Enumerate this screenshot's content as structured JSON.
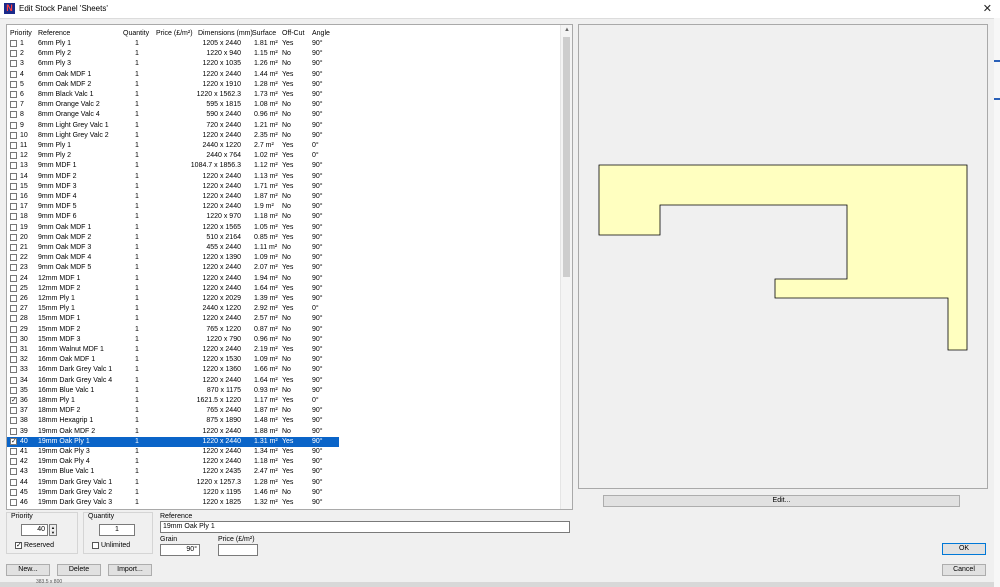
{
  "window": {
    "title": "Edit Stock Panel 'Sheets'",
    "close": "✕"
  },
  "table": {
    "headers": {
      "priority": "Priority",
      "reference": "Reference",
      "quantity": "Quantity",
      "price": "Price (£/m²)",
      "dimensions": "Dimensions (mm)",
      "surface": "Surface",
      "offcut": "Off-Cut",
      "angle": "Angle"
    },
    "selected_index": 39,
    "rows": [
      {
        "p": "1",
        "ref": "6mm Ply 1",
        "qty": "1",
        "dim": "1205 x 2440",
        "surf": "1.81 m²",
        "off": "Yes",
        "ang": "90°",
        "checked": false
      },
      {
        "p": "2",
        "ref": "6mm Ply 2",
        "qty": "1",
        "dim": "1220 x 940",
        "surf": "1.15 m²",
        "off": "No",
        "ang": "90°",
        "checked": false
      },
      {
        "p": "3",
        "ref": "6mm Ply 3",
        "qty": "1",
        "dim": "1220 x 1035",
        "surf": "1.26 m²",
        "off": "No",
        "ang": "90°",
        "checked": false
      },
      {
        "p": "4",
        "ref": "6mm Oak MDF 1",
        "qty": "1",
        "dim": "1220 x 2440",
        "surf": "1.44 m²",
        "off": "Yes",
        "ang": "90°",
        "checked": false
      },
      {
        "p": "5",
        "ref": "6mm Oak MDF 2",
        "qty": "1",
        "dim": "1220 x 1910",
        "surf": "1.28 m²",
        "off": "Yes",
        "ang": "90°",
        "checked": false
      },
      {
        "p": "6",
        "ref": "8mm Black Valc 1",
        "qty": "1",
        "dim": "1220 x 1562.3",
        "surf": "1.73 m²",
        "off": "Yes",
        "ang": "90°",
        "checked": false
      },
      {
        "p": "7",
        "ref": "8mm Orange Valc 2",
        "qty": "1",
        "dim": "595 x 1815",
        "surf": "1.08 m²",
        "off": "No",
        "ang": "90°",
        "checked": false
      },
      {
        "p": "8",
        "ref": "8mm Orange Valc 4",
        "qty": "1",
        "dim": "590 x 2440",
        "surf": "0.96 m²",
        "off": "No",
        "ang": "90°",
        "checked": false
      },
      {
        "p": "9",
        "ref": "8mm Light Grey Valc 1",
        "qty": "1",
        "dim": "720 x 2440",
        "surf": "1.21 m²",
        "off": "No",
        "ang": "90°",
        "checked": false
      },
      {
        "p": "10",
        "ref": "8mm Light Grey Valc 2",
        "qty": "1",
        "dim": "1220 x 2440",
        "surf": "2.35 m²",
        "off": "No",
        "ang": "90°",
        "checked": false
      },
      {
        "p": "11",
        "ref": "9mm Ply 1",
        "qty": "1",
        "dim": "2440 x 1220",
        "surf": "2.7 m²",
        "off": "Yes",
        "ang": "0°",
        "checked": false
      },
      {
        "p": "12",
        "ref": "9mm Ply 2",
        "qty": "1",
        "dim": "2440 x 764",
        "surf": "1.02 m²",
        "off": "Yes",
        "ang": "0°",
        "checked": false
      },
      {
        "p": "13",
        "ref": "9mm MDF 1",
        "qty": "1",
        "dim": "1084.7 x 1856.3",
        "surf": "1.12 m²",
        "off": "Yes",
        "ang": "90°",
        "checked": false
      },
      {
        "p": "14",
        "ref": "9mm MDF 2",
        "qty": "1",
        "dim": "1220 x 2440",
        "surf": "1.13 m²",
        "off": "Yes",
        "ang": "90°",
        "checked": false
      },
      {
        "p": "15",
        "ref": "9mm MDF 3",
        "qty": "1",
        "dim": "1220 x 2440",
        "surf": "1.71 m²",
        "off": "Yes",
        "ang": "90°",
        "checked": false
      },
      {
        "p": "16",
        "ref": "9mm MDF 4",
        "qty": "1",
        "dim": "1220 x 2440",
        "surf": "1.87 m²",
        "off": "No",
        "ang": "90°",
        "checked": false
      },
      {
        "p": "17",
        "ref": "9mm MDF 5",
        "qty": "1",
        "dim": "1220 x 2440",
        "surf": "1.9 m²",
        "off": "No",
        "ang": "90°",
        "checked": false
      },
      {
        "p": "18",
        "ref": "9mm MDF 6",
        "qty": "1",
        "dim": "1220 x 970",
        "surf": "1.18 m²",
        "off": "No",
        "ang": "90°",
        "checked": false
      },
      {
        "p": "19",
        "ref": "9mm Oak MDF 1",
        "qty": "1",
        "dim": "1220 x 1565",
        "surf": "1.05 m²",
        "off": "Yes",
        "ang": "90°",
        "checked": false
      },
      {
        "p": "20",
        "ref": "9mm Oak MDF 2",
        "qty": "1",
        "dim": "510 x 2164",
        "surf": "0.85 m²",
        "off": "Yes",
        "ang": "90°",
        "checked": false
      },
      {
        "p": "21",
        "ref": "9mm Oak MDF 3",
        "qty": "1",
        "dim": "455 x 2440",
        "surf": "1.11 m²",
        "off": "No",
        "ang": "90°",
        "checked": false
      },
      {
        "p": "22",
        "ref": "9mm Oak MDF 4",
        "qty": "1",
        "dim": "1220 x 1390",
        "surf": "1.09 m²",
        "off": "No",
        "ang": "90°",
        "checked": false
      },
      {
        "p": "23",
        "ref": "9mm Oak MDF 5",
        "qty": "1",
        "dim": "1220 x 2440",
        "surf": "2.07 m²",
        "off": "Yes",
        "ang": "90°",
        "checked": false
      },
      {
        "p": "24",
        "ref": "12mm MDF 1",
        "qty": "1",
        "dim": "1220 x 2440",
        "surf": "1.94 m²",
        "off": "No",
        "ang": "90°",
        "checked": false
      },
      {
        "p": "25",
        "ref": "12mm MDF 2",
        "qty": "1",
        "dim": "1220 x 2440",
        "surf": "1.64 m²",
        "off": "Yes",
        "ang": "90°",
        "checked": false
      },
      {
        "p": "26",
        "ref": "12mm Ply 1",
        "qty": "1",
        "dim": "1220 x 2029",
        "surf": "1.39 m²",
        "off": "Yes",
        "ang": "90°",
        "checked": false
      },
      {
        "p": "27",
        "ref": "15mm Ply 1",
        "qty": "1",
        "dim": "2440 x 1220",
        "surf": "2.92 m²",
        "off": "Yes",
        "ang": "0°",
        "checked": false
      },
      {
        "p": "28",
        "ref": "15mm MDF 1",
        "qty": "1",
        "dim": "1220 x 2440",
        "surf": "2.57 m²",
        "off": "No",
        "ang": "90°",
        "checked": false
      },
      {
        "p": "29",
        "ref": "15mm MDF 2",
        "qty": "1",
        "dim": "765 x 1220",
        "surf": "0.87 m²",
        "off": "No",
        "ang": "90°",
        "checked": false
      },
      {
        "p": "30",
        "ref": "15mm MDF 3",
        "qty": "1",
        "dim": "1220 x 790",
        "surf": "0.96 m²",
        "off": "No",
        "ang": "90°",
        "checked": false
      },
      {
        "p": "31",
        "ref": "16mm Walnut MDF 1",
        "qty": "1",
        "dim": "1220 x 2440",
        "surf": "2.19 m²",
        "off": "Yes",
        "ang": "90°",
        "checked": false
      },
      {
        "p": "32",
        "ref": "16mm Oak MDF 1",
        "qty": "1",
        "dim": "1220 x 1530",
        "surf": "1.09 m²",
        "off": "No",
        "ang": "90°",
        "checked": false
      },
      {
        "p": "33",
        "ref": "16mm Dark Grey Valc 1",
        "qty": "1",
        "dim": "1220 x 1360",
        "surf": "1.66 m²",
        "off": "No",
        "ang": "90°",
        "checked": false
      },
      {
        "p": "34",
        "ref": "16mm Dark Grey Valc 4",
        "qty": "1",
        "dim": "1220 x 2440",
        "surf": "1.64 m²",
        "off": "Yes",
        "ang": "90°",
        "checked": false
      },
      {
        "p": "35",
        "ref": "16mm Blue Valc 1",
        "qty": "1",
        "dim": "870 x 1175",
        "surf": "0.93 m²",
        "off": "No",
        "ang": "90°",
        "checked": false
      },
      {
        "p": "36",
        "ref": "18mm Ply 1",
        "qty": "1",
        "dim": "1621.5 x 1220",
        "surf": "1.17 m²",
        "off": "Yes",
        "ang": "0°",
        "checked": true
      },
      {
        "p": "37",
        "ref": "18mm MDF 2",
        "qty": "1",
        "dim": "765 x 2440",
        "surf": "1.87 m²",
        "off": "No",
        "ang": "90°",
        "checked": false
      },
      {
        "p": "38",
        "ref": "18mm Hexagrip 1",
        "qty": "1",
        "dim": "875 x 1890",
        "surf": "1.48 m²",
        "off": "Yes",
        "ang": "90°",
        "checked": false
      },
      {
        "p": "39",
        "ref": "19mm Oak MDF 2",
        "qty": "1",
        "dim": "1220 x 2440",
        "surf": "1.88 m²",
        "off": "No",
        "ang": "90°",
        "checked": false
      },
      {
        "p": "40",
        "ref": "19mm Oak Ply 1",
        "qty": "1",
        "dim": "1220 x 2440",
        "surf": "1.31 m²",
        "off": "Yes",
        "ang": "90°",
        "checked": true
      },
      {
        "p": "41",
        "ref": "19mm Oak Ply 3",
        "qty": "1",
        "dim": "1220 x 2440",
        "surf": "1.34 m²",
        "off": "Yes",
        "ang": "90°",
        "checked": false
      },
      {
        "p": "42",
        "ref": "19mm Oak Ply 4",
        "qty": "1",
        "dim": "1220 x 2440",
        "surf": "1.18 m²",
        "off": "Yes",
        "ang": "90°",
        "checked": false
      },
      {
        "p": "43",
        "ref": "19mm Blue Valc 1",
        "qty": "1",
        "dim": "1220 x 2435",
        "surf": "2.47 m²",
        "off": "Yes",
        "ang": "90°",
        "checked": false
      },
      {
        "p": "44",
        "ref": "19mm Dark Grey Valc 1",
        "qty": "1",
        "dim": "1220 x 1257.3",
        "surf": "1.28 m²",
        "off": "Yes",
        "ang": "90°",
        "checked": false
      },
      {
        "p": "45",
        "ref": "19mm Dark Grey Valc 2",
        "qty": "1",
        "dim": "1220 x 1195",
        "surf": "1.46 m²",
        "off": "No",
        "ang": "90°",
        "checked": false
      },
      {
        "p": "46",
        "ref": "19mm Dark Grey Valc 3",
        "qty": "1",
        "dim": "1220 x 1825",
        "surf": "1.32 m²",
        "off": "Yes",
        "ang": "90°",
        "checked": false
      }
    ]
  },
  "preview": {
    "shape_fill": "#ffffc0",
    "stroke": "#000000"
  },
  "buttons": {
    "edit": "Edit...",
    "new": "New...",
    "delete": "Delete",
    "import": "Import...",
    "ok": "OK",
    "cancel": "Cancel"
  },
  "form": {
    "priority_label": "Priority",
    "priority_value": "40",
    "reserved_label": "Reserved",
    "reserved_checked": true,
    "quantity_label": "Quantity",
    "quantity_value": "1",
    "unlimited_label": "Unlimited",
    "unlimited_checked": false,
    "reference_label": "Reference",
    "reference_value": "19mm Oak Ply 1",
    "grain_label": "Grain",
    "grain_value": "90°",
    "price_label": "Price (£/m²)",
    "price_value": ""
  },
  "background": {
    "partial_text": "383.5 x 800"
  },
  "colors": {
    "selection": "#0a64c8",
    "app_icon": "#1a2a8a"
  }
}
